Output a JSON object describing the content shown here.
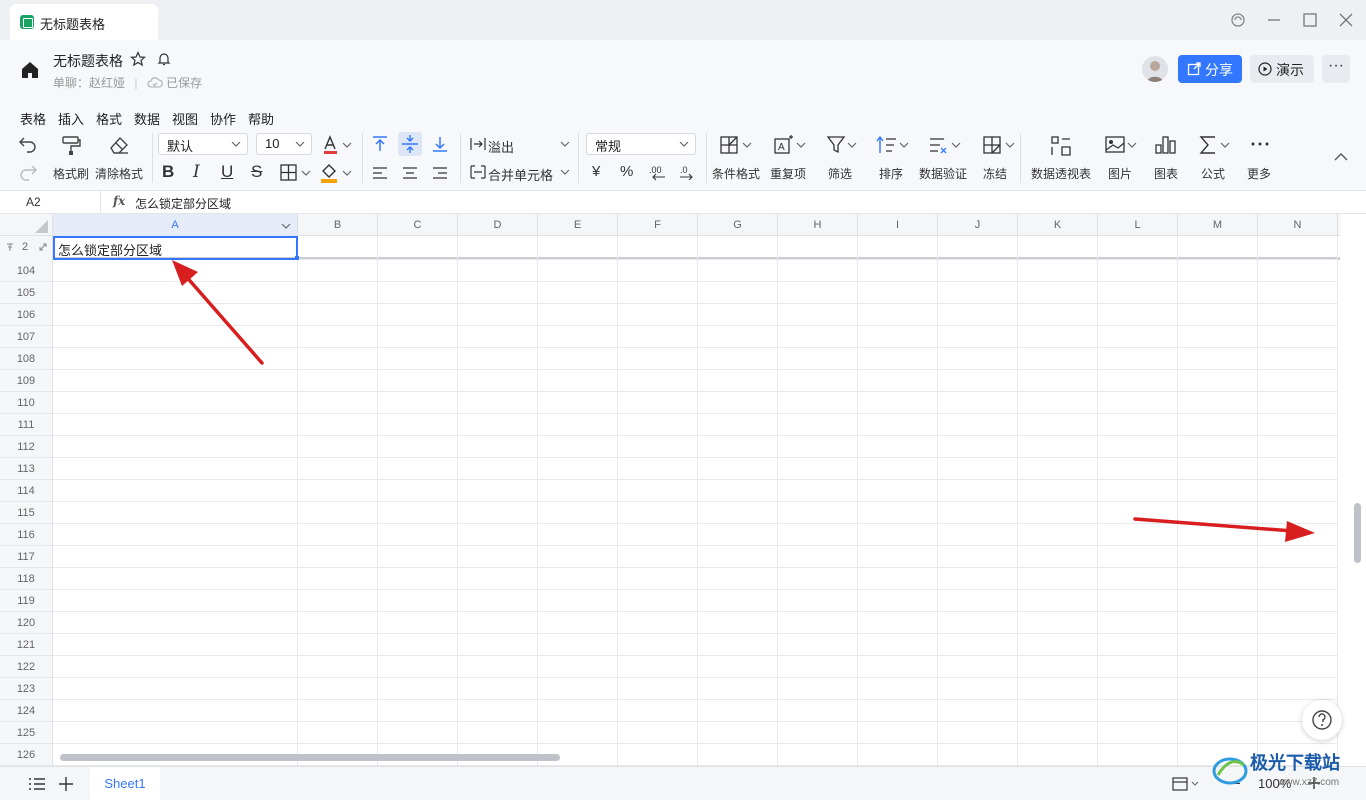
{
  "window": {
    "tab_title": "无标题表格"
  },
  "header": {
    "doc_title": "无标题表格",
    "owner": "单聊：赵红娅",
    "save_status": "已保存",
    "share_label": "分享",
    "present_label": "演示",
    "more_label": "···"
  },
  "menu": [
    "表格",
    "插入",
    "格式",
    "数据",
    "视图",
    "协作",
    "帮助"
  ],
  "toolbar": {
    "format_painter": "格式刷",
    "clear_format": "清除格式",
    "font_family": "默认",
    "font_size": "10",
    "overflow": "溢出",
    "merge_cells": "合并单元格",
    "number_format": "常规",
    "conditional_format": "条件格式",
    "duplicates": "重复项",
    "filter": "筛选",
    "sort": "排序",
    "data_validation": "数据验证",
    "freeze": "冻结",
    "pivot_table": "数据透视表",
    "image": "图片",
    "chart": "图表",
    "formula": "公式",
    "more": "更多",
    "bold": "B",
    "italic": "I",
    "underline": "U",
    "strikethrough": "S",
    "currency": "¥",
    "percent": "%"
  },
  "formula_bar": {
    "cell_ref": "A2",
    "fx": "fx",
    "value": "怎么锁定部分区域"
  },
  "grid": {
    "columns": [
      "A",
      "B",
      "C",
      "D",
      "E",
      "F",
      "G",
      "H",
      "I",
      "J",
      "K",
      "L",
      "M",
      "N"
    ],
    "frozen_row_number": "2",
    "frozen_row_value": "怎么锁定部分区域",
    "rows": [
      "104",
      "105",
      "106",
      "107",
      "108",
      "109",
      "110",
      "111",
      "112",
      "113",
      "114",
      "115",
      "116",
      "117",
      "118",
      "119",
      "120",
      "121",
      "122",
      "123",
      "124",
      "125",
      "126"
    ]
  },
  "bottom": {
    "sheet_name": "Sheet1",
    "zoom": "100%"
  },
  "watermark": {
    "text": "极光下载站",
    "url": "www.xz7.com"
  },
  "colors": {
    "accent": "#3377ff",
    "arrow": "#d81e1e",
    "sheet_icon": "#19a463"
  }
}
